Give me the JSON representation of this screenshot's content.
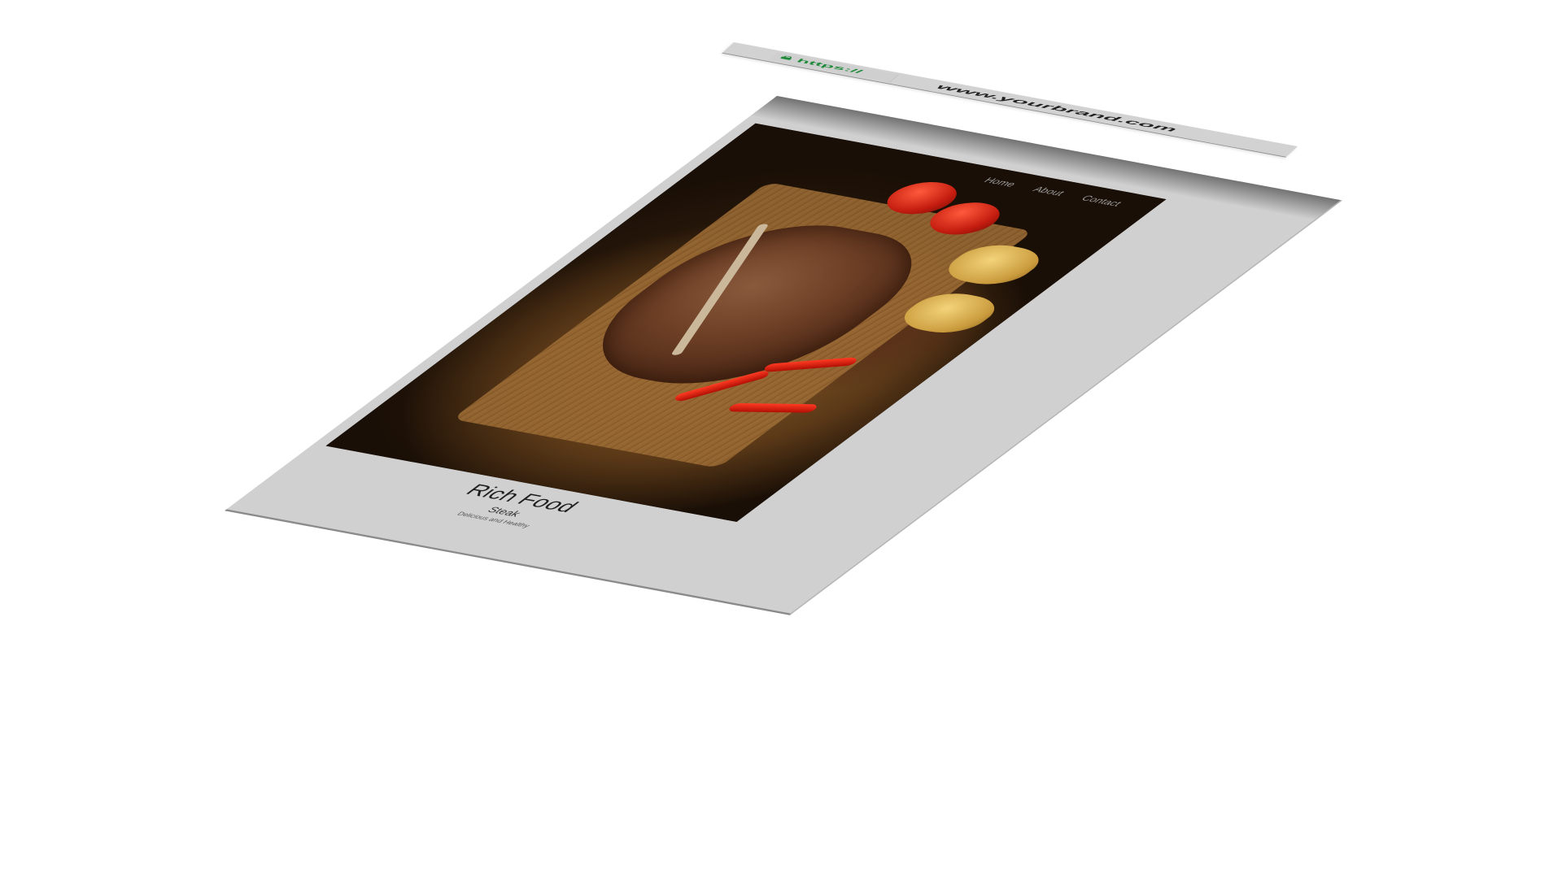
{
  "address_bar": {
    "protocol": "https://",
    "url": "www.yourbrand.com",
    "lock_icon": "lock-icon",
    "protocol_color": "#1e8a3a"
  },
  "nav": {
    "items": [
      {
        "label": "Home"
      },
      {
        "label": "About"
      },
      {
        "label": "Contact"
      }
    ]
  },
  "hero": {
    "image": "steak-photo"
  },
  "caption": {
    "title": "Rich Food",
    "subtitle": "Steak",
    "tagline": "Delicious and Healthy"
  },
  "colors": {
    "page_background": "#d0d0d0",
    "bar_background": "#d2d2d2"
  }
}
